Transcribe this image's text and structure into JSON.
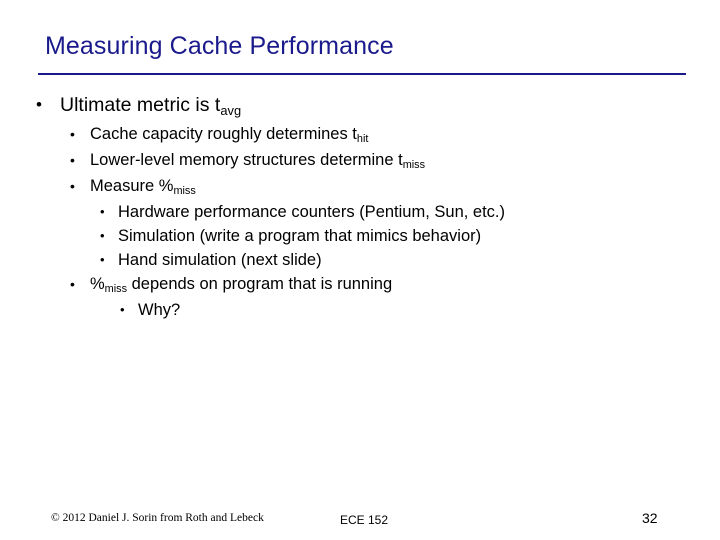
{
  "slide": {
    "title": "Measuring Cache Performance",
    "content": {
      "l1_text_pre": "Ultimate metric is t",
      "l1_text_sub": "avg",
      "b1_pre": "Cache capacity roughly determines t",
      "b1_sub": "hit",
      "b2_pre": "Lower-level memory structures determine t",
      "b2_sub": "miss",
      "b3_pre": "Measure %",
      "b3_sub": "miss",
      "c1": "Hardware performance counters (Pentium, Sun, etc.)",
      "c2": "Simulation (write a program that mimics behavior)",
      "c3": "Hand simulation (next slide)",
      "b4_pre": "%",
      "b4_sub": "miss",
      "b4_post": " depends on program that is running",
      "d1": "Why?"
    },
    "bullets": {
      "level1": "•",
      "level2": "•",
      "level3": "•",
      "level4": "•"
    },
    "footer": {
      "copyright": "© 2012 Daniel J. Sorin from Roth and Lebeck",
      "course": "ECE 152",
      "page_number": "32"
    },
    "colors": {
      "title": "#1a1a8c",
      "body_text": "#000000",
      "rule": "#1a1a8c"
    }
  }
}
